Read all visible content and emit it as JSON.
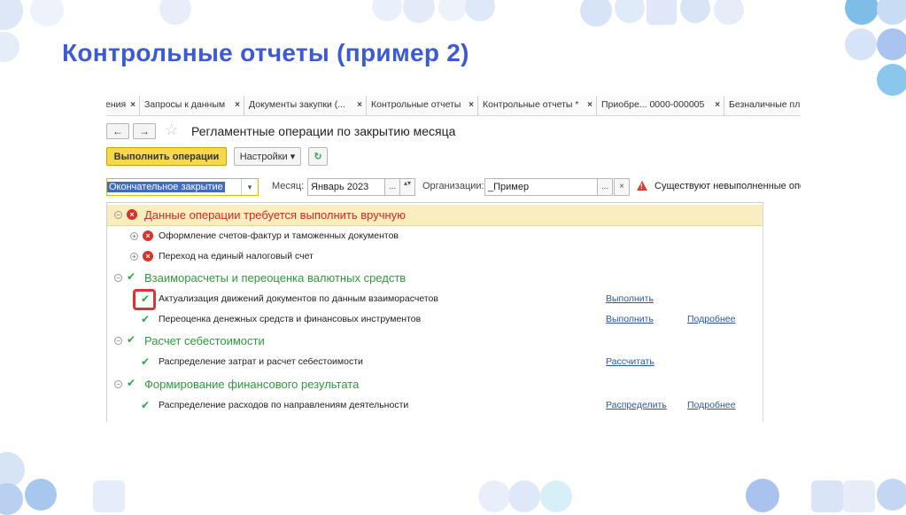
{
  "slide": {
    "title": "Контрольные отчеты (пример 2)"
  },
  "tabs": [
    {
      "label": "ения",
      "close": "×"
    },
    {
      "label": "Запросы к данным",
      "close": "×"
    },
    {
      "label": "Документы закупки (...",
      "close": "×"
    },
    {
      "label": "Контрольные отчеты",
      "close": "×"
    },
    {
      "label": "Контрольные отчеты *",
      "close": "×"
    },
    {
      "label": "Приобре... 0000-000005",
      "close": "×"
    },
    {
      "label": "Безналичные пл",
      "close": ""
    }
  ],
  "nav": {
    "back": "←",
    "forward": "→",
    "favorite": "☆"
  },
  "document": {
    "title": "Регламентные операции по закрытию месяца"
  },
  "toolbar": {
    "run_label": "Выполнить операции",
    "settings_label": "Настройки ▾",
    "refresh": "↻"
  },
  "filters": {
    "closing_type": "Окончательное закрытие",
    "month_label": "Месяц:",
    "month_value": "Январь 2023",
    "org_label": "Организации:",
    "org_value": "_Пример",
    "dots": "...",
    "clear": "×",
    "dropdown": "▾",
    "spin": "▴▾",
    "warning_text": "Существуют невыполненные опер"
  },
  "tree": {
    "toggle_collapse": "⊖",
    "toggle_expand": "⊕",
    "err_mark": "×",
    "ok_mark": "✔",
    "groups": [
      {
        "label": "Данные операции требуется выполнить вручную",
        "items": [
          {
            "label": "Оформление счетов-фактур и таможенных документов"
          },
          {
            "label": "Переход на единый налоговый счет"
          }
        ]
      },
      {
        "label": "Взаиморасчеты и переоценка валютных средств",
        "items": [
          {
            "label": "Актуализация движений документов по данным взаиморасчетов",
            "action": "Выполнить"
          },
          {
            "label": "Переоценка денежных средств и финансовых инструментов",
            "action": "Выполнить",
            "details": "Подробнее"
          }
        ]
      },
      {
        "label": "Расчет себестоимости",
        "items": [
          {
            "label": "Распределение затрат и расчет себестоимости",
            "action": "Рассчитать"
          }
        ]
      },
      {
        "label": "Формирование финансового результата",
        "items": [
          {
            "label": "Распределение расходов по направлениям деятельности",
            "action": "Распределить",
            "details": "Подробнее"
          }
        ]
      }
    ]
  },
  "colors": {
    "accent": "#3b5bd6",
    "primary_button": "#f6d84e",
    "error": "#d52a1f",
    "ok": "#2f9a3a",
    "link": "#2a55b5"
  }
}
